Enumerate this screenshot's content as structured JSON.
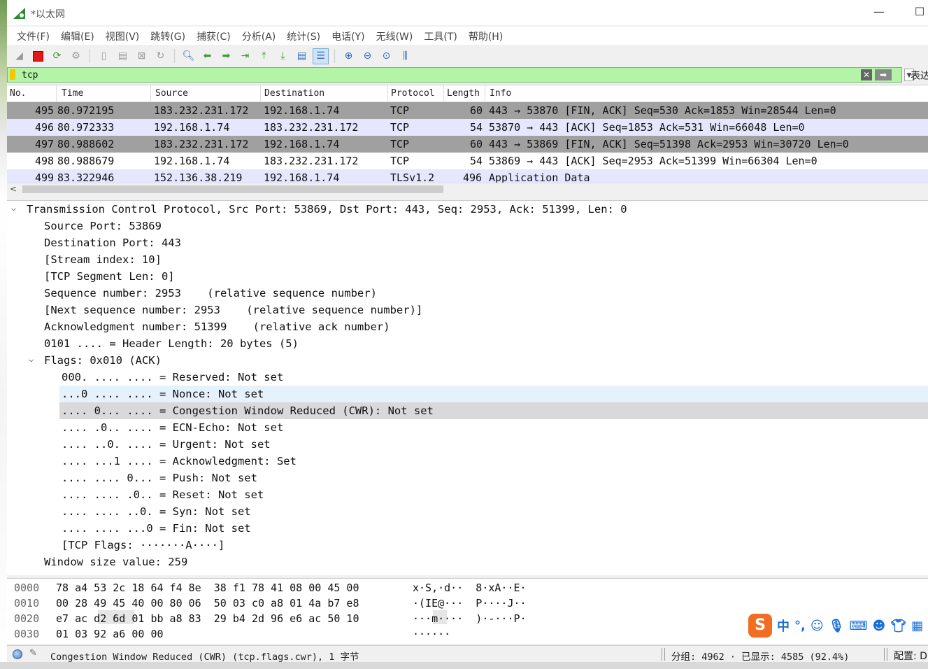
{
  "window": {
    "title": "*以太网"
  },
  "menu": [
    "文件(F)",
    "编辑(E)",
    "视图(V)",
    "跳转(G)",
    "捕获(C)",
    "分析(A)",
    "统计(S)",
    "电话(Y)",
    "无线(W)",
    "工具(T)",
    "帮助(H)"
  ],
  "filter": {
    "value": "tcp",
    "expression_label": "表达式…"
  },
  "packet_list": {
    "columns": [
      "No.",
      "Time",
      "Source",
      "Destination",
      "Protocol",
      "Length",
      "Info"
    ],
    "rows": [
      {
        "no": "495",
        "time": "80.972195",
        "source": "183.232.231.172",
        "destination": "192.168.1.74",
        "protocol": "TCP",
        "length": "60",
        "info": "443 → 53870 [FIN, ACK] Seq=530 Ack=1853 Win=28544 Len=0",
        "color": "gray"
      },
      {
        "no": "496",
        "time": "80.972333",
        "source": "192.168.1.74",
        "destination": "183.232.231.172",
        "protocol": "TCP",
        "length": "54",
        "info": "53870 → 443 [ACK] Seq=1853 Ack=531 Win=66048 Len=0",
        "color": "lavender"
      },
      {
        "no": "497",
        "time": "80.988602",
        "source": "183.232.231.172",
        "destination": "192.168.1.74",
        "protocol": "TCP",
        "length": "60",
        "info": "443 → 53869 [FIN, ACK] Seq=51398 Ack=2953 Win=30720 Len=0",
        "color": "gray"
      },
      {
        "no": "498",
        "time": "80.988679",
        "source": "192.168.1.74",
        "destination": "183.232.231.172",
        "protocol": "TCP",
        "length": "54",
        "info": "53869 → 443 [ACK] Seq=2953 Ack=51399 Win=66304 Len=0",
        "color": "white"
      },
      {
        "no": "499",
        "time": "83.322946",
        "source": "152.136.38.219",
        "destination": "192.168.1.74",
        "protocol": "TLSv1.2",
        "length": "496",
        "info": "Application Data",
        "color": "lavender"
      }
    ]
  },
  "details": [
    {
      "text": "Transmission Control Protocol, Src Port: 53869, Dst Port: 443, Seq: 2953, Ack: 51399, Len: 0",
      "indent": 0,
      "expanded": true
    },
    {
      "text": "Source Port: 53869",
      "indent": 1
    },
    {
      "text": "Destination Port: 443",
      "indent": 1
    },
    {
      "text": "[Stream index: 10]",
      "indent": 1
    },
    {
      "text": "[TCP Segment Len: 0]",
      "indent": 1
    },
    {
      "text": "Sequence number: 2953    (relative sequence number)",
      "indent": 1
    },
    {
      "text": "[Next sequence number: 2953    (relative sequence number)]",
      "indent": 1
    },
    {
      "text": "Acknowledgment number: 51399    (relative ack number)",
      "indent": 1
    },
    {
      "text": "0101 .... = Header Length: 20 bytes (5)",
      "indent": 1
    },
    {
      "text": "Flags: 0x010 (ACK)",
      "indent": 1,
      "expanded": true
    },
    {
      "text": "000. .... .... = Reserved: Not set",
      "indent": 2
    },
    {
      "text": "...0 .... .... = Nonce: Not set",
      "indent": 2,
      "highlight": "hover"
    },
    {
      "text": ".... 0... .... = Congestion Window Reduced (CWR): Not set",
      "indent": 2,
      "highlight": "selected"
    },
    {
      "text": ".... .0.. .... = ECN-Echo: Not set",
      "indent": 2
    },
    {
      "text": ".... ..0. .... = Urgent: Not set",
      "indent": 2
    },
    {
      "text": ".... ...1 .... = Acknowledgment: Set",
      "indent": 2
    },
    {
      "text": ".... .... 0... = Push: Not set",
      "indent": 2
    },
    {
      "text": ".... .... .0.. = Reset: Not set",
      "indent": 2
    },
    {
      "text": ".... .... ..0. = Syn: Not set",
      "indent": 2
    },
    {
      "text": ".... .... ...0 = Fin: Not set",
      "indent": 2
    },
    {
      "text": "[TCP Flags: ·······A····]",
      "indent": 2
    },
    {
      "text": "Window size value: 259",
      "indent": 1
    }
  ],
  "bytes": [
    {
      "offset": "0000",
      "hex": "78 a4 53 2c 18 64 f4 8e  38 f1 78 41 08 00 45 00",
      "ascii": "x·S,·d··  8·xA··E·"
    },
    {
      "offset": "0010",
      "hex": "00 28 49 45 40 00 80 06  50 03 c0 a8 01 4a b7 e8",
      "ascii": "·(IE@···  P····J··"
    },
    {
      "offset": "0020",
      "hex": "e7 ac d2 6d 01 bb a8 83  29 b4 2d 96 e6 ac 50 10",
      "ascii": "···m····  )·-···P·"
    },
    {
      "offset": "0030",
      "hex": "01 03 92 a6 00 00",
      "ascii": "······"
    }
  ],
  "status": {
    "field": "Congestion Window Reduced (CWR) (tcp.flags.cwr), 1 字节",
    "stats": "分组: 4962 · 已显示: 4585 (92.4%)",
    "profile": "配置: D"
  },
  "ime": {
    "logo": "S",
    "mode": "中"
  }
}
